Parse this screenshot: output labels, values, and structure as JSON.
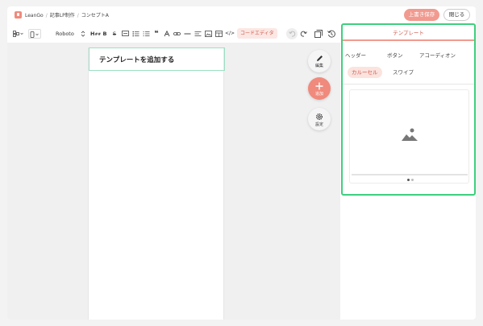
{
  "header": {
    "brand": "LeanGo",
    "crumb2": "記事LP制作",
    "crumb3": "コンセプトA",
    "separator": "/",
    "save_label": "上書き保存",
    "close_label": "閉じる"
  },
  "toolbar": {
    "font": "Roboto",
    "heading": "H",
    "bold": "B",
    "strike": "S",
    "quote": "❝",
    "link": "∞",
    "code_label": "コードエディタ",
    "code_tag": "</>"
  },
  "canvas": {
    "page_title": "テンプレートを追加する"
  },
  "fabs": {
    "edit": "編集",
    "add": "追加",
    "settings": "設定"
  },
  "panel": {
    "tab": "テンプレート",
    "chips": [
      "ヘッダー",
      "ボタン",
      "アコーディオン",
      "カルーセル",
      "スワイプ"
    ],
    "active_chip": "カルーセル",
    "carousel_pages": 2,
    "carousel_active": 1
  },
  "colors": {
    "accent": "#f08a7c",
    "panel_border": "#3ecf7e",
    "title_border": "#9ce0c5"
  }
}
